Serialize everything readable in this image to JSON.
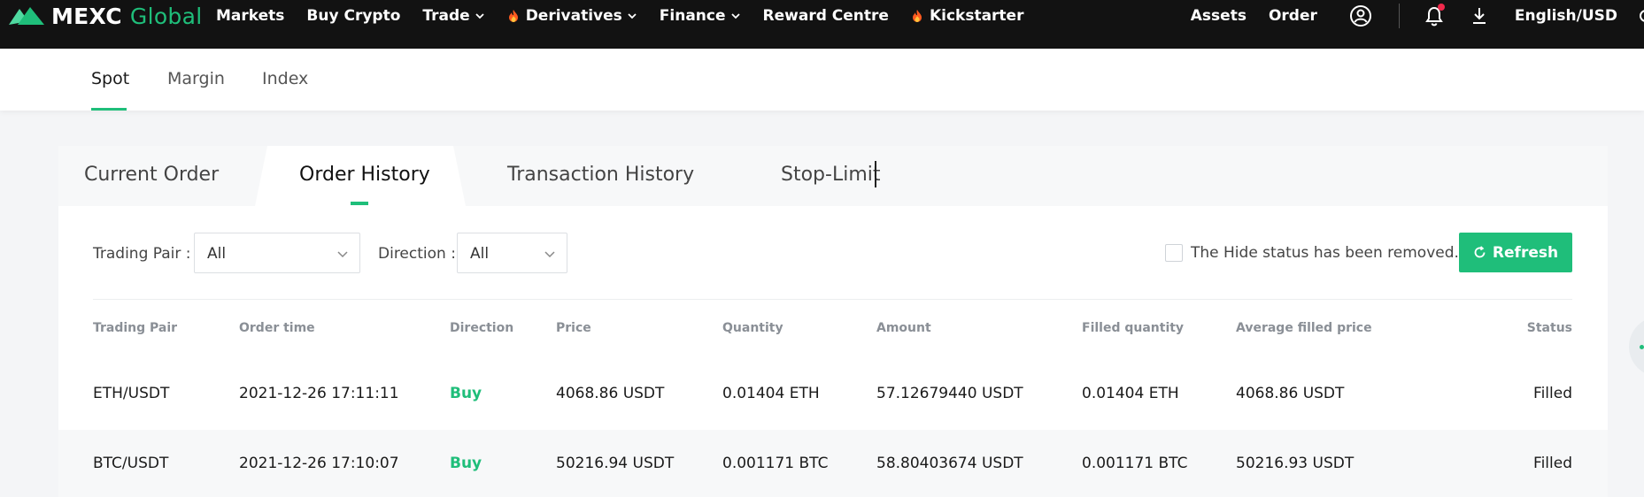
{
  "brand": {
    "name": "MEXC",
    "suffix": "Global"
  },
  "nav": {
    "markets": "Markets",
    "buy_crypto": "Buy Crypto",
    "trade": "Trade",
    "derivatives": "Derivatives",
    "finance": "Finance",
    "reward_centre": "Reward Centre",
    "kickstarter": "Kickstarter",
    "assets": "Assets",
    "order": "Order",
    "language": "English/USD"
  },
  "subnav": {
    "spot": "Spot",
    "margin": "Margin",
    "index": "Index"
  },
  "order_tabs": {
    "current": "Current Order",
    "history": "Order History",
    "transactions": "Transaction History",
    "stop_limit": "Stop-Limit"
  },
  "filters": {
    "trading_pair_label": "Trading Pair :",
    "trading_pair_value": "All",
    "direction_label": "Direction :",
    "direction_value": "All",
    "hide_status_text": "The Hide status has been removed.",
    "refresh_label": "Refresh"
  },
  "table": {
    "headers": {
      "pair": "Trading Pair",
      "time": "Order time",
      "direction": "Direction",
      "price": "Price",
      "quantity": "Quantity",
      "amount": "Amount",
      "filled_qty": "Filled quantity",
      "avg_price": "Average filled price",
      "status": "Status"
    },
    "rows": [
      {
        "pair": "ETH/USDT",
        "time": "2021-12-26 17:11:11",
        "direction": "Buy",
        "price": "4068.86 USDT",
        "quantity": "0.01404 ETH",
        "amount": "57.12679440 USDT",
        "filled_qty": "0.01404 ETH",
        "avg_price": "4068.86 USDT",
        "status": "Filled"
      },
      {
        "pair": "BTC/USDT",
        "time": "2021-12-26 17:10:07",
        "direction": "Buy",
        "price": "50216.94 USDT",
        "quantity": "0.001171 BTC",
        "amount": "58.80403674 USDT",
        "filled_qty": "0.001171 BTC",
        "avg_price": "50216.93 USDT",
        "status": "Filled"
      }
    ]
  },
  "icons": {
    "user": "user-circle-icon",
    "bell": "bell-icon",
    "download": "download-icon",
    "refresh": "refresh-icon",
    "fire": "fire-icon"
  },
  "colors": {
    "brand_green": "#1fbe7a",
    "topbar_bg": "#121212",
    "notification_red": "#f0294b"
  }
}
